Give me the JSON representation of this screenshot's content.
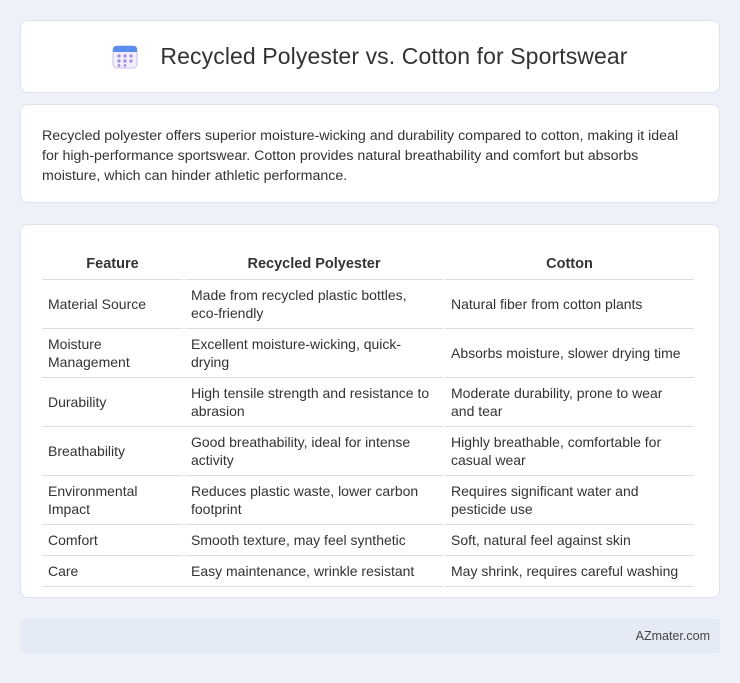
{
  "header": {
    "title": "Recycled Polyester vs. Cotton for Sportswear",
    "icon": "calendar-icon"
  },
  "summary": {
    "text": "Recycled polyester offers superior moisture-wicking and durability compared to cotton, making it ideal for high-performance sportswear. Cotton provides natural breathability and comfort but absorbs moisture, which can hinder athletic performance."
  },
  "table": {
    "headers": [
      "Feature",
      "Recycled Polyester",
      "Cotton"
    ],
    "rows": [
      [
        "Material Source",
        "Made from recycled plastic bottles, eco-friendly",
        "Natural fiber from cotton plants"
      ],
      [
        "Moisture Management",
        "Excellent moisture-wicking, quick-drying",
        "Absorbs moisture, slower drying time"
      ],
      [
        "Durability",
        "High tensile strength and resistance to abrasion",
        "Moderate durability, prone to wear and tear"
      ],
      [
        "Breathability",
        "Good breathability, ideal for intense activity",
        "Highly breathable, comfortable for casual wear"
      ],
      [
        "Environmental Impact",
        "Reduces plastic waste, lower carbon footprint",
        "Requires significant water and pesticide use"
      ],
      [
        "Comfort",
        "Smooth texture, may feel synthetic",
        "Soft, natural feel against skin"
      ],
      [
        "Care",
        "Easy maintenance, wrinkle resistant",
        "May shrink, requires careful washing"
      ]
    ]
  },
  "footer": {
    "brand": "AZmater.com"
  },
  "colors": {
    "background": "#eef2f8",
    "card": "#ffffff",
    "footer_bg": "#e4ebf6",
    "icon_blue": "#5b8def",
    "icon_purple": "#a88ad8"
  }
}
